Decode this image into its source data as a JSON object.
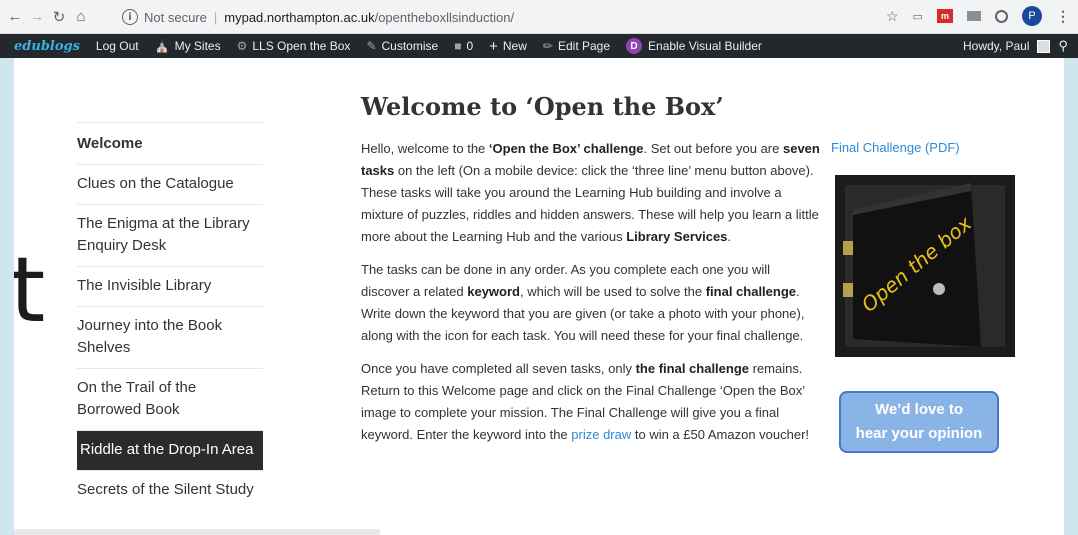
{
  "browser": {
    "not_secure": "Not secure",
    "separator": "|",
    "host": "mypad.northampton.ac.uk",
    "path": "/opentheboxllsinduction/",
    "profile_initial": "P",
    "ext_label": "m"
  },
  "adminbar": {
    "logo": "edublogs",
    "items": [
      {
        "label": "Log Out"
      },
      {
        "label": "My Sites"
      },
      {
        "label": "LLS Open the Box"
      },
      {
        "label": "Customise"
      },
      {
        "label": "0"
      },
      {
        "label": "New"
      },
      {
        "label": "Edit Page"
      },
      {
        "label": "Enable Visual Builder"
      }
    ],
    "visual_builder_badge": "D",
    "howdy": "Howdy, Paul"
  },
  "sidebar": {
    "items": [
      {
        "label": "Welcome"
      },
      {
        "label": "Clues on the Catalogue"
      },
      {
        "label": "The Enigma at the Library Enquiry Desk"
      },
      {
        "label": "The Invisible Library"
      },
      {
        "label": "Journey into the Book Shelves"
      },
      {
        "label": "On the Trail of the Borrowed Book"
      },
      {
        "label": "Riddle at the Drop-In Area"
      },
      {
        "label": "Secrets of the Silent Study"
      }
    ]
  },
  "background_glyph": "t",
  "main": {
    "title": "Welcome to ‘Open the Box’",
    "p1": {
      "t1": "Hello, welcome to the ",
      "b1": "‘Open the Box’ challenge",
      "t2": ". Set out before you are ",
      "b2": "seven tasks",
      "t3": " on the left (On a mobile device: click the ‘three line’ menu button above). These tasks will take you around the Learning Hub building and involve a mixture of puzzles, riddles and hidden answers. These will help you learn a little more about the Learning Hub and the various ",
      "b3": "Library Services",
      "t4": "."
    },
    "p2": {
      "t1": "The tasks can be done in any order. As you complete each one you will discover a related ",
      "b1": "keyword",
      "t2": ", which will be used to solve the ",
      "b2": "final challenge",
      "t3": ". Write down the keyword that you are given (or take a photo with your phone), along with the icon for each task. You will need these for your final challenge."
    },
    "p3": {
      "t1": "Once you have completed all seven tasks, only ",
      "b1": "the final challenge",
      "t2": " remains. Return to this Welcome page and click on the Final Challenge ‘Open the Box’ image to complete your mission. The Final Challenge will give you a final keyword. Enter the keyword into the ",
      "link": "prize draw",
      "t3": " to win a £50 Amazon voucher!"
    }
  },
  "right": {
    "pdf_link": "Final Challenge (PDF)",
    "box_text": "Open the box",
    "feedback_line1": "We’d love to",
    "feedback_line2": "hear your opinion"
  }
}
